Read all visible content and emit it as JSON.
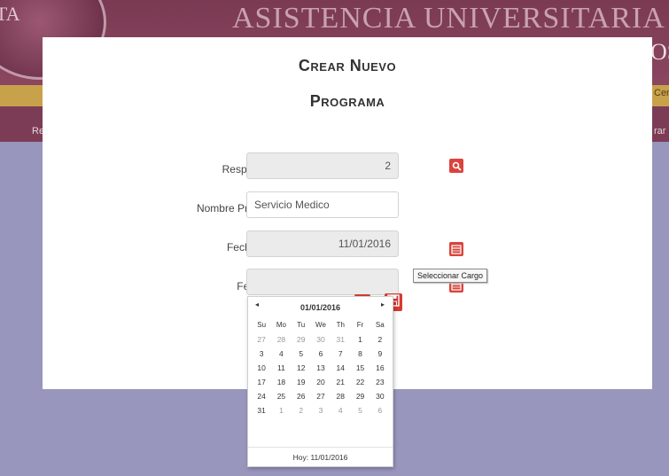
{
  "background": {
    "title": "ASISTENCIA UNIVERSITARIA",
    "logo_text": "UTA",
    "right_edge_title": "OS",
    "gold_bar_right": "Cer",
    "nav_left": "Re",
    "nav_right": "rar"
  },
  "modal": {
    "title_line1": "Crear Nuevo",
    "title_line2": "Programa",
    "responsable": {
      "label": "Responsable:",
      "value": "2"
    },
    "nombre": {
      "label": "Nombre Programa:",
      "value": "Servicio Medico"
    },
    "fecha_inicio": {
      "label": "Fecha Inicio:",
      "value": "11/01/2016"
    },
    "fecha_fin": {
      "label": "Fecha Fin:",
      "value": ""
    },
    "tooltip": "Seleccionar Cargo",
    "icons": {
      "search": "search-icon",
      "calendar": "calendar-icon",
      "close": "close-icon",
      "save": "save-icon"
    },
    "accent_color": "#d9443c"
  },
  "datepicker": {
    "prev": "◂",
    "next": "▸",
    "month": "01/01/2016",
    "days_of_week": [
      "Su",
      "Mo",
      "Tu",
      "We",
      "Th",
      "Fr",
      "Sa"
    ],
    "weeks": [
      [
        "27",
        "28",
        "29",
        "30",
        "31",
        "1",
        "2"
      ],
      [
        "3",
        "4",
        "5",
        "6",
        "7",
        "8",
        "9"
      ],
      [
        "10",
        "11",
        "12",
        "13",
        "14",
        "15",
        "16"
      ],
      [
        "17",
        "18",
        "19",
        "20",
        "21",
        "22",
        "23"
      ],
      [
        "24",
        "25",
        "26",
        "27",
        "28",
        "29",
        "30"
      ],
      [
        "31",
        "1",
        "2",
        "3",
        "4",
        "5",
        "6"
      ]
    ],
    "today_label": "Hoy: 11/01/2016"
  }
}
